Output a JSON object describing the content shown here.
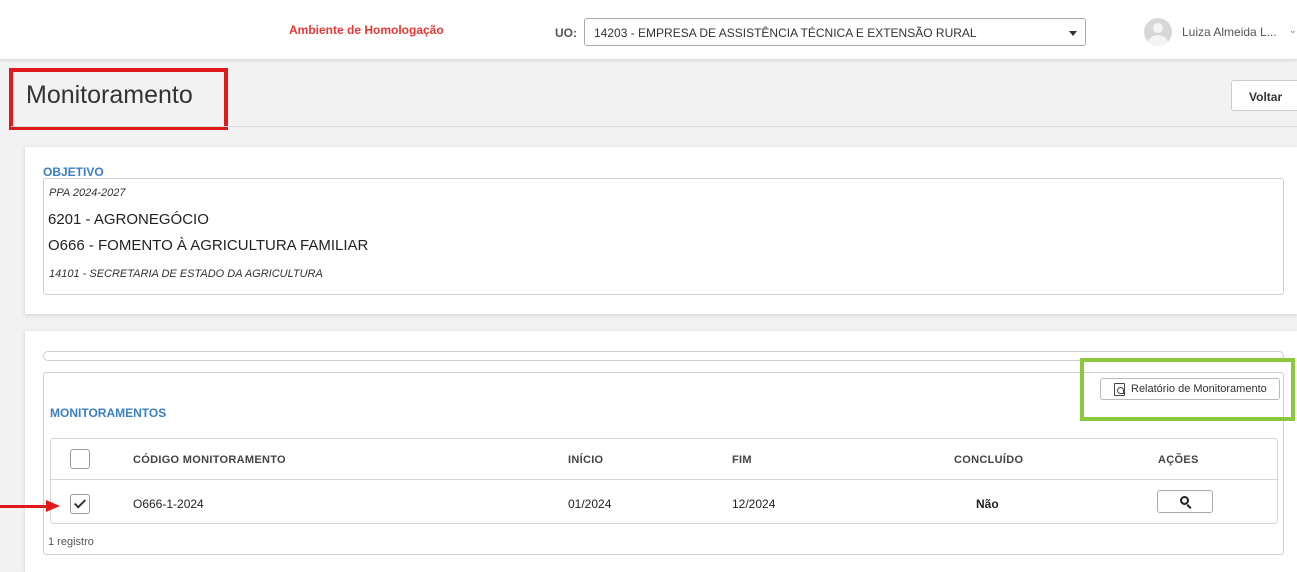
{
  "header": {
    "environment_label": "Ambiente de Homologação",
    "uo_label": "UO:",
    "uo_selected": "14203 - EMPRESA DE ASSISTÊNCIA TÉCNICA E EXTENSÃO RURAL",
    "user_name": "Luiza Almeida L...",
    "user_chevron": "⌄"
  },
  "page": {
    "title": "Monitoramento",
    "back_button": "Voltar"
  },
  "objetivo": {
    "label": "OBJETIVO",
    "ppa": "PPA 2024-2027",
    "line1": "6201 - AGRONEGÓCIO",
    "line2": "O666 - FOMENTO À AGRICULTURA FAMILIAR",
    "secretaria": "14101 - SECRETARIA DE ESTADO DA AGRICULTURA"
  },
  "monitoramentos": {
    "label": "MONITORAMENTOS",
    "report_button": "Relatório de Monitoramento",
    "columns": [
      "CÓDIGO MONITORAMENTO",
      "INÍCIO",
      "FIM",
      "CONCLUÍDO",
      "AÇÕES"
    ],
    "rows": [
      {
        "checked": true,
        "codigo": "O666-1-2024",
        "inicio": "01/2024",
        "fim": "12/2024",
        "concluido": "Não"
      }
    ],
    "footer": "1 registro"
  },
  "icons": {
    "avatar": "user-avatar-icon",
    "report": "pdf-icon",
    "action": "search-icon",
    "dropdown": "chevron-down-icon"
  },
  "colors": {
    "environment": "#e53935",
    "section_label": "#3a7fc4",
    "annotation_red": "#e0191f",
    "annotation_green": "#8dc63f"
  }
}
